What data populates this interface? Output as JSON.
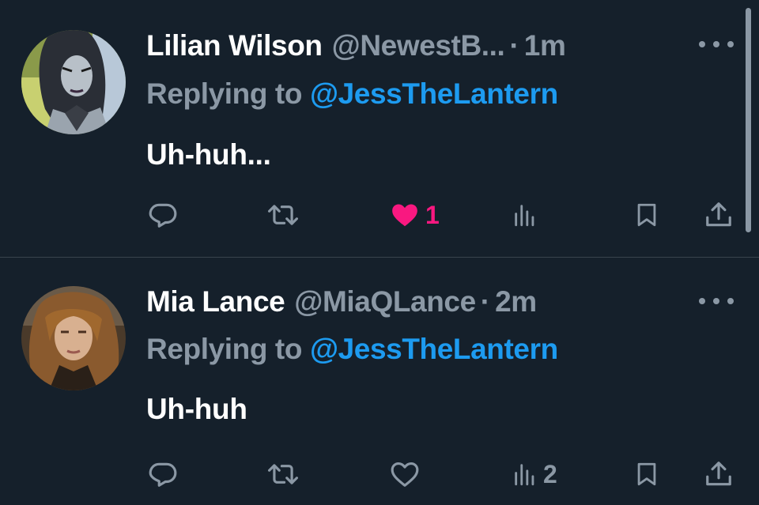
{
  "tweets": [
    {
      "name": "Lilian Wilson",
      "handle": "@NewestB...",
      "separator": "·",
      "time": "1m",
      "replying_prefix": "Replying to",
      "replying_to": "@JessTheLantern",
      "content": "Uh-huh...",
      "likes": "1",
      "views": "",
      "liked": true
    },
    {
      "name": "Mia Lance",
      "handle": "@MiaQLance",
      "separator": "·",
      "time": "2m",
      "replying_prefix": "Replying to",
      "replying_to": "@JessTheLantern",
      "content": "Uh-huh",
      "likes": "",
      "views": "2",
      "liked": false
    }
  ],
  "icons": {
    "reply": "reply-icon",
    "retweet": "retweet-icon",
    "like": "heart-icon",
    "views": "views-chart-icon",
    "bookmark": "bookmark-icon",
    "share": "share-icon",
    "more": "more-dots-icon"
  },
  "colors": {
    "background": "#15202b",
    "text": "#ffffff",
    "muted": "#8b98a5",
    "link": "#1d9bf0",
    "like": "#f91880",
    "divider": "#38444d"
  }
}
